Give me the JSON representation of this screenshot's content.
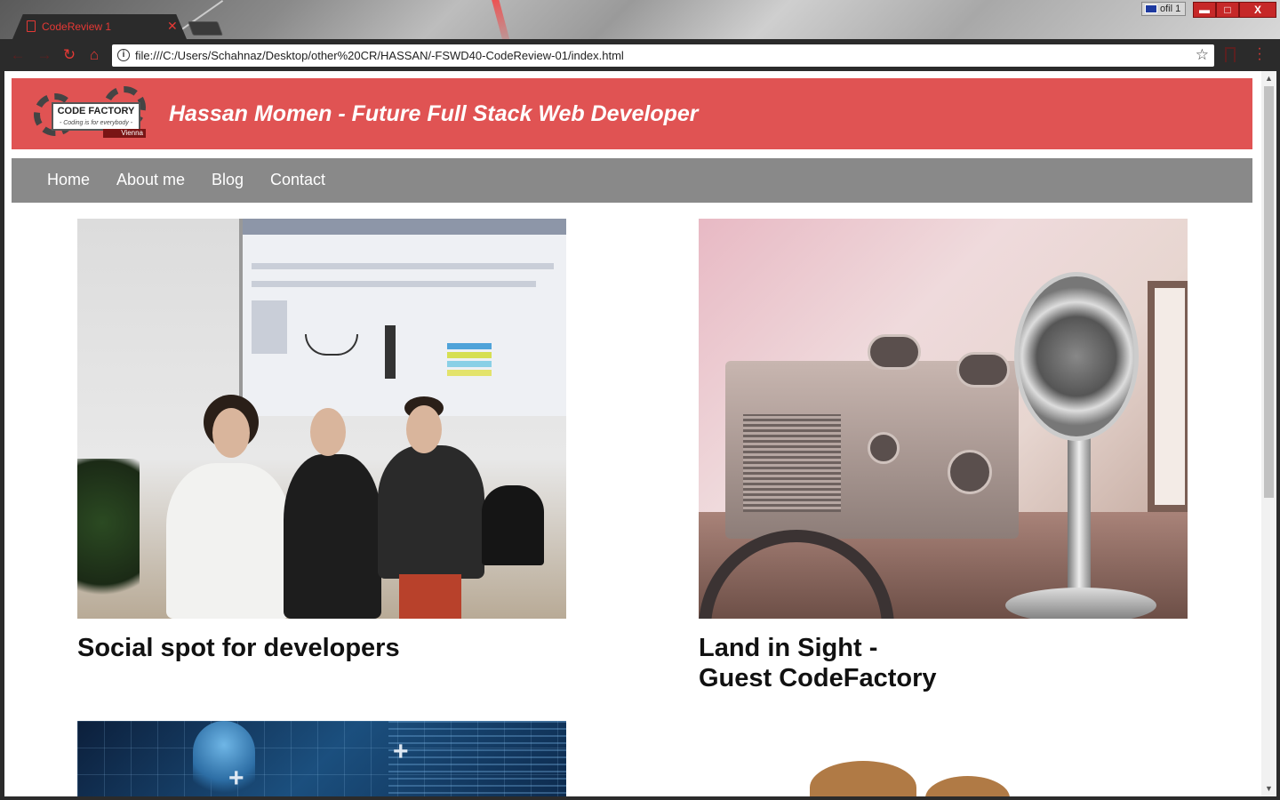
{
  "browser": {
    "tab_title": "CodeReview 1",
    "profile_label": "ofil 1",
    "url": "file:///C:/Users/Schahnaz/Desktop/other%20CR/HASSAN/-FSWD40-CodeReview-01/index.html",
    "window_controls": {
      "minimize": "▬",
      "maximize": "□",
      "close": "X"
    }
  },
  "header": {
    "logo": {
      "name": "CODE FACTORY",
      "tagline": "- Coding is for everybody -",
      "city": "Vienna"
    },
    "title": "Hassan Momen - Future Full Stack Web Developer"
  },
  "nav": {
    "items": [
      {
        "label": "Home"
      },
      {
        "label": "About me"
      },
      {
        "label": "Blog"
      },
      {
        "label": "Contact"
      }
    ]
  },
  "cards": [
    {
      "title": "Social spot for developers"
    },
    {
      "title_line1": "Land in Sight -",
      "title_line2": "Guest CodeFactory"
    }
  ],
  "icons": [
    "file-icon",
    "close-icon",
    "back-icon",
    "forward-icon",
    "reload-icon",
    "home-icon",
    "info-icon",
    "star-icon",
    "bookmark-icon",
    "menu-icon"
  ],
  "colors": {
    "header": "#e05353",
    "nav": "#898989",
    "accent": "#e53935"
  }
}
